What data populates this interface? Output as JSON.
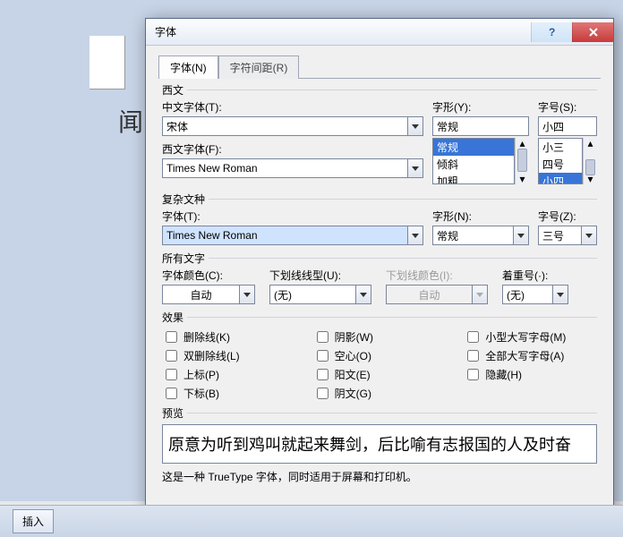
{
  "background": {
    "doc_text": "闻"
  },
  "titlebar": {
    "title": "字体"
  },
  "tabs": {
    "active": "字体(N)",
    "inactive": "字符间距(R)"
  },
  "group_western": "西文",
  "labels": {
    "cn_font": "中文字体(T):",
    "west_font": "西文字体(F):",
    "style": "字形(Y):",
    "size": "字号(S):",
    "complex_font": "字体(T):",
    "complex_style": "字形(N):",
    "complex_size": "字号(Z):",
    "font_color": "字体颜色(C):",
    "underline": "下划线线型(U):",
    "underline_color": "下划线颜色(I):",
    "emphasis": "着重号(·):"
  },
  "fields": {
    "cn_font": "宋体",
    "west_font": "Times New Roman",
    "style_value": "常规",
    "style_list": [
      "常规",
      "倾斜",
      "加粗"
    ],
    "style_selected_index": 0,
    "size_value": "小四",
    "size_list": [
      "小三",
      "四号",
      "小四"
    ],
    "size_selected_index": 2,
    "complex_font": "Times New Roman",
    "complex_style": "常规",
    "complex_size": "三号",
    "font_color": "自动",
    "underline": "(无)",
    "underline_color": "自动",
    "emphasis": "(无)"
  },
  "group_complex": "复杂文种",
  "group_all": "所有文字",
  "group_effects": "效果",
  "effects": [
    {
      "label": "删除线(K)"
    },
    {
      "label": "双删除线(L)"
    },
    {
      "label": "上标(P)"
    },
    {
      "label": "下标(B)"
    },
    {
      "label": "阴影(W)"
    },
    {
      "label": "空心(O)"
    },
    {
      "label": "阳文(E)"
    },
    {
      "label": "阴文(G)"
    },
    {
      "label": "小型大写字母(M)"
    },
    {
      "label": "全部大写字母(A)"
    },
    {
      "label": "隐藏(H)"
    }
  ],
  "group_preview": "预览",
  "preview_text": "原意为听到鸡叫就起来舞剑，后比喻有志报国的人及时奋",
  "hint": "这是一种 TrueType 字体，同时适用于屏幕和打印机。",
  "bottombar": {
    "insert": "插入"
  }
}
